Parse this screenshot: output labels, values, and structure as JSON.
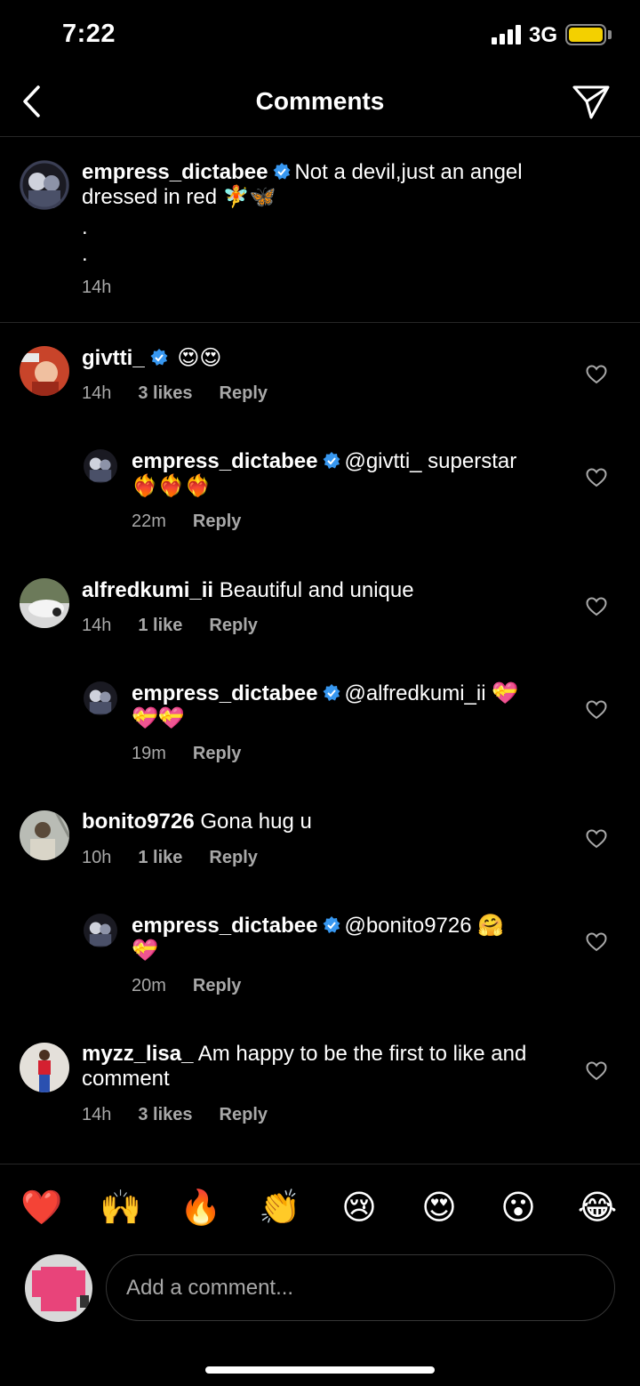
{
  "status_bar": {
    "time": "7:22",
    "network": "3G"
  },
  "nav": {
    "title": "Comments"
  },
  "caption": {
    "username": "empress_dictabee",
    "text": "Not a devil,just an angel",
    "text_line2": "dressed in red 🧚🦋",
    "dot1": ".",
    "dot2": ".",
    "time": "14h"
  },
  "comments": [
    {
      "username": "givtti_",
      "text": "😍😍",
      "time": "14h",
      "likes": "3 likes",
      "reply": "Reply"
    },
    {
      "username": "empress_dictabee",
      "text": "@givtti_ superstar",
      "text_line2": "❤️‍🔥❤️‍🔥❤️‍🔥",
      "time": "22m",
      "reply": "Reply"
    },
    {
      "username": "alfredkumi_ii",
      "text": "Beautiful and unique",
      "time": "14h",
      "likes": "1 like",
      "reply": "Reply"
    },
    {
      "username": "empress_dictabee",
      "text": "@alfredkumi_ii 💝",
      "text_line2": "💝💝",
      "time": "19m",
      "reply": "Reply"
    },
    {
      "username": "bonito9726",
      "text": "Gona hug u",
      "time": "10h",
      "likes": "1 like",
      "reply": "Reply"
    },
    {
      "username": "empress_dictabee",
      "text": "@bonito9726 🤗",
      "text_line2": "💝",
      "time": "20m",
      "reply": "Reply"
    },
    {
      "username": "myzz_lisa_",
      "text": "Am happy to be the first to like and",
      "text_line2": "comment",
      "time": "14h",
      "likes": "3 likes",
      "reply": "Reply"
    }
  ],
  "emoji_bar": [
    "❤️",
    "🙌",
    "🔥",
    "👏",
    "😢",
    "😍",
    "😮",
    "😂"
  ],
  "composer": {
    "placeholder": "Add a comment..."
  },
  "colors": {
    "background": "#000000",
    "verified": "#3797f0",
    "muted_text": "#a8a8a8",
    "battery": "#f3d000"
  }
}
